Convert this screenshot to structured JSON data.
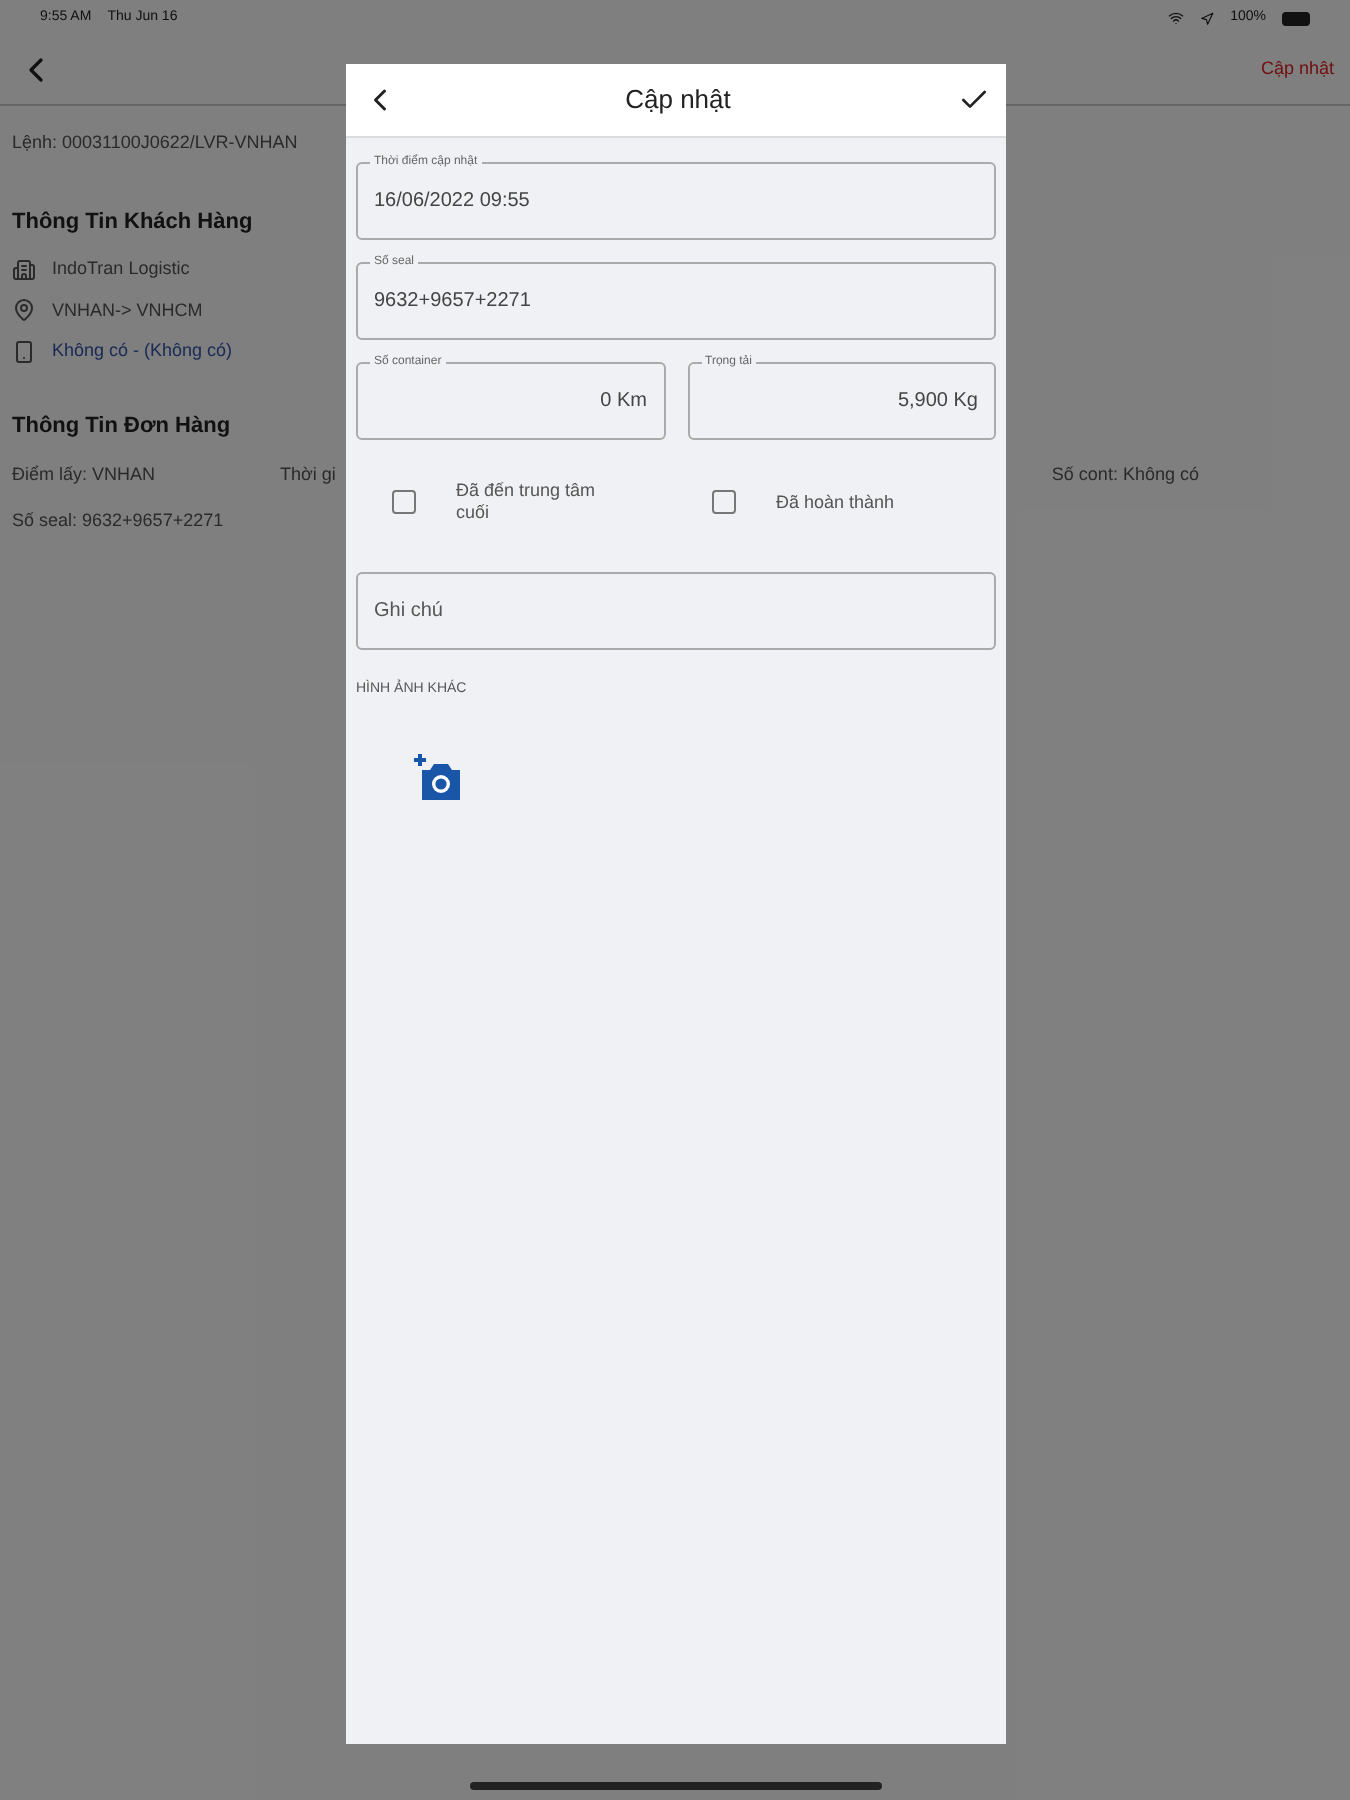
{
  "status_bar": {
    "time": "9:55 AM",
    "date": "Thu Jun 16",
    "battery": "100%"
  },
  "background_page": {
    "nav_action": "Cập nhật",
    "order_line": "Lệnh: 00031100J0622/LVR-VNHAN",
    "customer_section": {
      "title": "Thông Tin Khách Hàng",
      "items": [
        {
          "kind": "company",
          "text": "IndoTran Logistic",
          "link": false
        },
        {
          "kind": "route",
          "text": "VNHAN-> VNHCM",
          "link": false
        },
        {
          "kind": "phone",
          "text": "Không có - (Không có)",
          "link": true
        }
      ]
    },
    "order_section": {
      "title": "Thông Tin Đơn Hàng",
      "pickup": "Điểm lấy: VNHAN",
      "time_cut": "Thời gi",
      "container": "Số cont: Không có",
      "seal": "Số seal: 9632+9657+2271"
    }
  },
  "dialog": {
    "title": "Cập nhật",
    "fields": [
      {
        "label": "Thời điểm cập nhật",
        "value": "16/06/2022 09:55"
      },
      {
        "label": "Số seal",
        "value": "9632+9657+2271"
      }
    ],
    "half_fields": [
      {
        "label": "Số container",
        "value": "0 Km"
      },
      {
        "label": "Trọng tải",
        "value": "5,900 Kg"
      }
    ],
    "checkboxes": [
      {
        "label": "Đã đến trung tâm cuối",
        "checked": false
      },
      {
        "label": "Đã hoàn thành",
        "checked": false
      }
    ],
    "note": {
      "placeholder": "Ghi chú"
    },
    "images_heading": "HÌNH ẢNH KHÁC"
  }
}
